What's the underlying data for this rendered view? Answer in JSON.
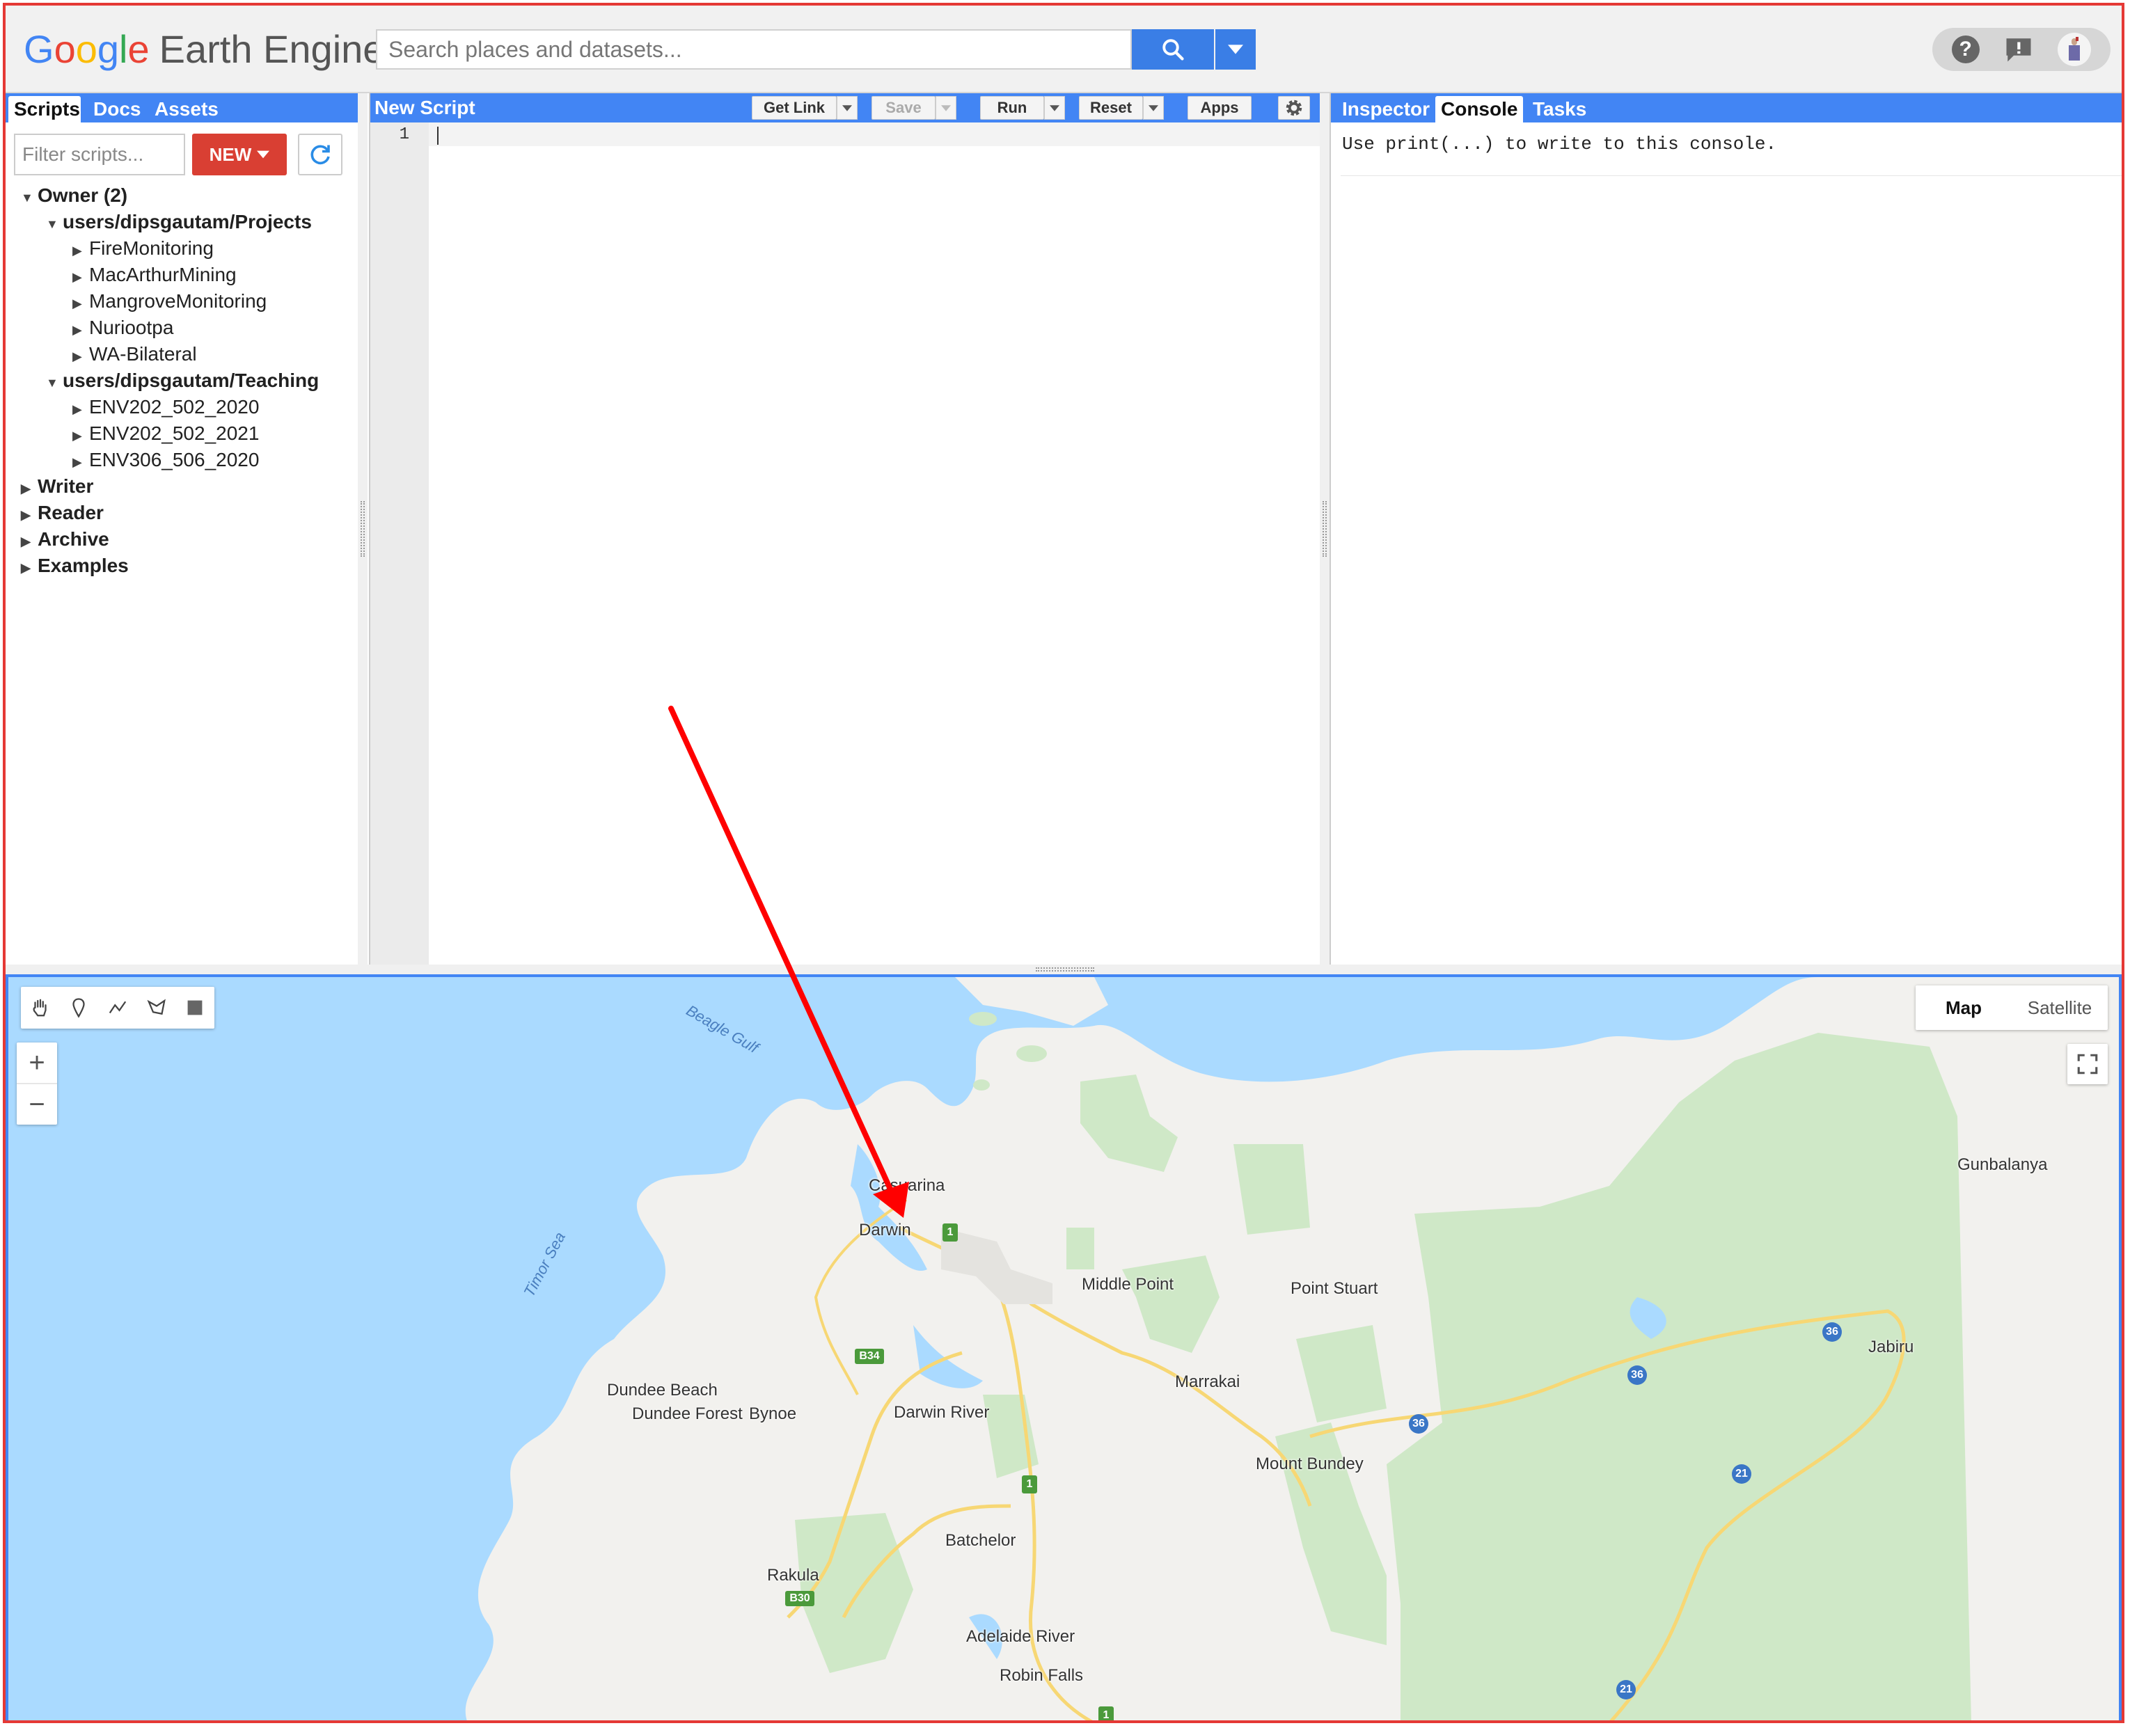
{
  "app": {
    "logo_google": [
      "G",
      "o",
      "o",
      "g",
      "l",
      "e"
    ],
    "logo_suffix": "Earth Engine",
    "search_placeholder": "Search places and datasets..."
  },
  "left_panel": {
    "tabs": [
      "Scripts",
      "Docs",
      "Assets"
    ],
    "filter_placeholder": "Filter scripts...",
    "new_label": "NEW",
    "tree": [
      {
        "label": "Owner  (2)",
        "bold": true,
        "expanded": true
      },
      {
        "label": "users/dipsgautam/Projects",
        "bold": true,
        "expanded": true
      },
      {
        "label": "FireMonitoring"
      },
      {
        "label": "MacArthurMining"
      },
      {
        "label": "MangroveMonitoring"
      },
      {
        "label": "Nuriootpa"
      },
      {
        "label": "WA-Bilateral"
      },
      {
        "label": "users/dipsgautam/Teaching",
        "bold": true,
        "expanded": true
      },
      {
        "label": "ENV202_502_2020"
      },
      {
        "label": "ENV202_502_2021"
      },
      {
        "label": "ENV306_506_2020"
      },
      {
        "label": "Writer",
        "bold": true
      },
      {
        "label": "Reader",
        "bold": true
      },
      {
        "label": "Archive",
        "bold": true
      },
      {
        "label": "Examples",
        "bold": true
      }
    ]
  },
  "editor": {
    "title": "New Script",
    "get_link": "Get Link",
    "save": "Save",
    "run": "Run",
    "reset": "Reset",
    "apps": "Apps",
    "line_number": "1"
  },
  "right_panel": {
    "tabs": [
      "Inspector",
      "Console",
      "Tasks"
    ],
    "console_message": "Use print(...) to write to this console."
  },
  "map": {
    "map_label": "Map",
    "satellite_label": "Satellite",
    "zoom_in": "+",
    "zoom_out": "−",
    "places": {
      "casuarina": "Casuarina",
      "darwin": "Darwin",
      "middle_point": "Middle Point",
      "point_stuart": "Point Stuart",
      "gunbalanya": "Gunbalanya",
      "jabiru": "Jabiru",
      "dundee_beach": "Dundee Beach",
      "dundee_forest": "Dundee Forest",
      "bynoe": "Bynoe",
      "darwin_river": "Darwin River",
      "marrakai": "Marrakai",
      "mount_bundey": "Mount Bundey",
      "batchelor": "Batchelor",
      "rakula": "Rakula",
      "adelaide_river": "Adelaide River",
      "robin_falls": "Robin Falls"
    },
    "water": {
      "beagle_gulf": "Beagle Gulf",
      "timor_sea": "Timor Sea"
    },
    "shields": {
      "r36": "36",
      "r21": "21",
      "r1": "1",
      "b34": "B34",
      "b30": "B30"
    }
  },
  "colors": {
    "accent": "#4285f4",
    "new_button": "#d93f33",
    "annotation_arrow": "#ff0000",
    "frame_border": "#e53935"
  }
}
